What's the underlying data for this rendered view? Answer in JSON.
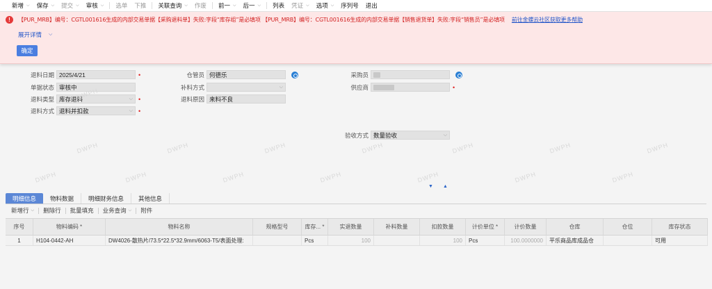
{
  "toolbar": {
    "items": [
      {
        "label": "新增",
        "caret": true,
        "dim": false
      },
      {
        "label": "保存",
        "caret": true,
        "dim": false
      },
      {
        "label": "提交",
        "caret": true,
        "dim": true
      },
      {
        "label": "审核",
        "caret": true,
        "dim": false
      },
      {
        "label": "选单",
        "caret": false,
        "dim": true
      },
      {
        "label": "下推",
        "caret": false,
        "dim": true
      },
      {
        "label": "关联查询",
        "caret": true,
        "dim": false
      },
      {
        "label": "作废",
        "caret": false,
        "dim": true
      },
      {
        "label": "前一",
        "caret": true,
        "dim": false
      },
      {
        "label": "后一",
        "caret": true,
        "dim": false
      },
      {
        "label": "列表",
        "caret": false,
        "dim": false
      },
      {
        "label": "凭证",
        "caret": true,
        "dim": true
      },
      {
        "label": "选项",
        "caret": true,
        "dim": false
      },
      {
        "label": "序列号",
        "caret": false,
        "dim": false
      },
      {
        "label": "退出",
        "caret": false,
        "dim": false
      }
    ]
  },
  "error": {
    "icon": "exclamation-icon",
    "message": "【PUR_MRB】编号：CGTL001616生成的内部交易单据【采购退料单】失败:字段“库存组”是必填项 【PUR_MRB】编号：CGTL001616生成的内部交易单据【销售退货单】失败:字段“销售员”是必填项",
    "link": "前往金蝶云社区获取更多帮助",
    "expand_label": "展开详情",
    "ok_label": "确定"
  },
  "form": {
    "return_date_label": "退料日期",
    "return_date": "2025/4/21",
    "status_label": "单据状态",
    "status": "审核中",
    "return_type_label": "退料类型",
    "return_type": "库存退料",
    "return_method_label": "退料方式",
    "return_method": "退料并扣款",
    "keeper_label": "仓管员",
    "keeper": "何德乐",
    "supplement_label": "补料方式",
    "supplement": "",
    "reason_label": "退料原因",
    "reason": "来料不良",
    "buyer_label": "采购员",
    "supplier_label": "供应商",
    "inspect_label": "验收方式",
    "inspect": "数量验收"
  },
  "tabs": [
    "明细信息",
    "物料数据",
    "明细财务信息",
    "其他信息"
  ],
  "subbar": [
    {
      "label": "新增行",
      "caret": true
    },
    {
      "label": "删除行",
      "caret": false
    },
    {
      "label": "批量填充",
      "caret": false
    },
    {
      "label": "业务查询",
      "caret": true
    },
    {
      "label": "附件",
      "caret": false
    }
  ],
  "grid": {
    "headers": [
      "序号",
      "物料编码 *",
      "物料名称",
      "规格型号",
      "库存... *",
      "实退数量",
      "补料数量",
      "扣款数量",
      "计价单位 *",
      "计价数量",
      "仓库",
      "仓位",
      "库存状态"
    ],
    "rows": [
      [
        "1",
        "H104-0442-AH",
        "DW4026-散热片/73.5*22.5*32.9mm/6063-T5/表面处理:",
        "",
        "Pcs",
        "100",
        "",
        "100",
        "Pcs",
        "100.0000000",
        "平乐商品库成品仓",
        "",
        "可用"
      ]
    ]
  },
  "watermark": "DWPH"
}
